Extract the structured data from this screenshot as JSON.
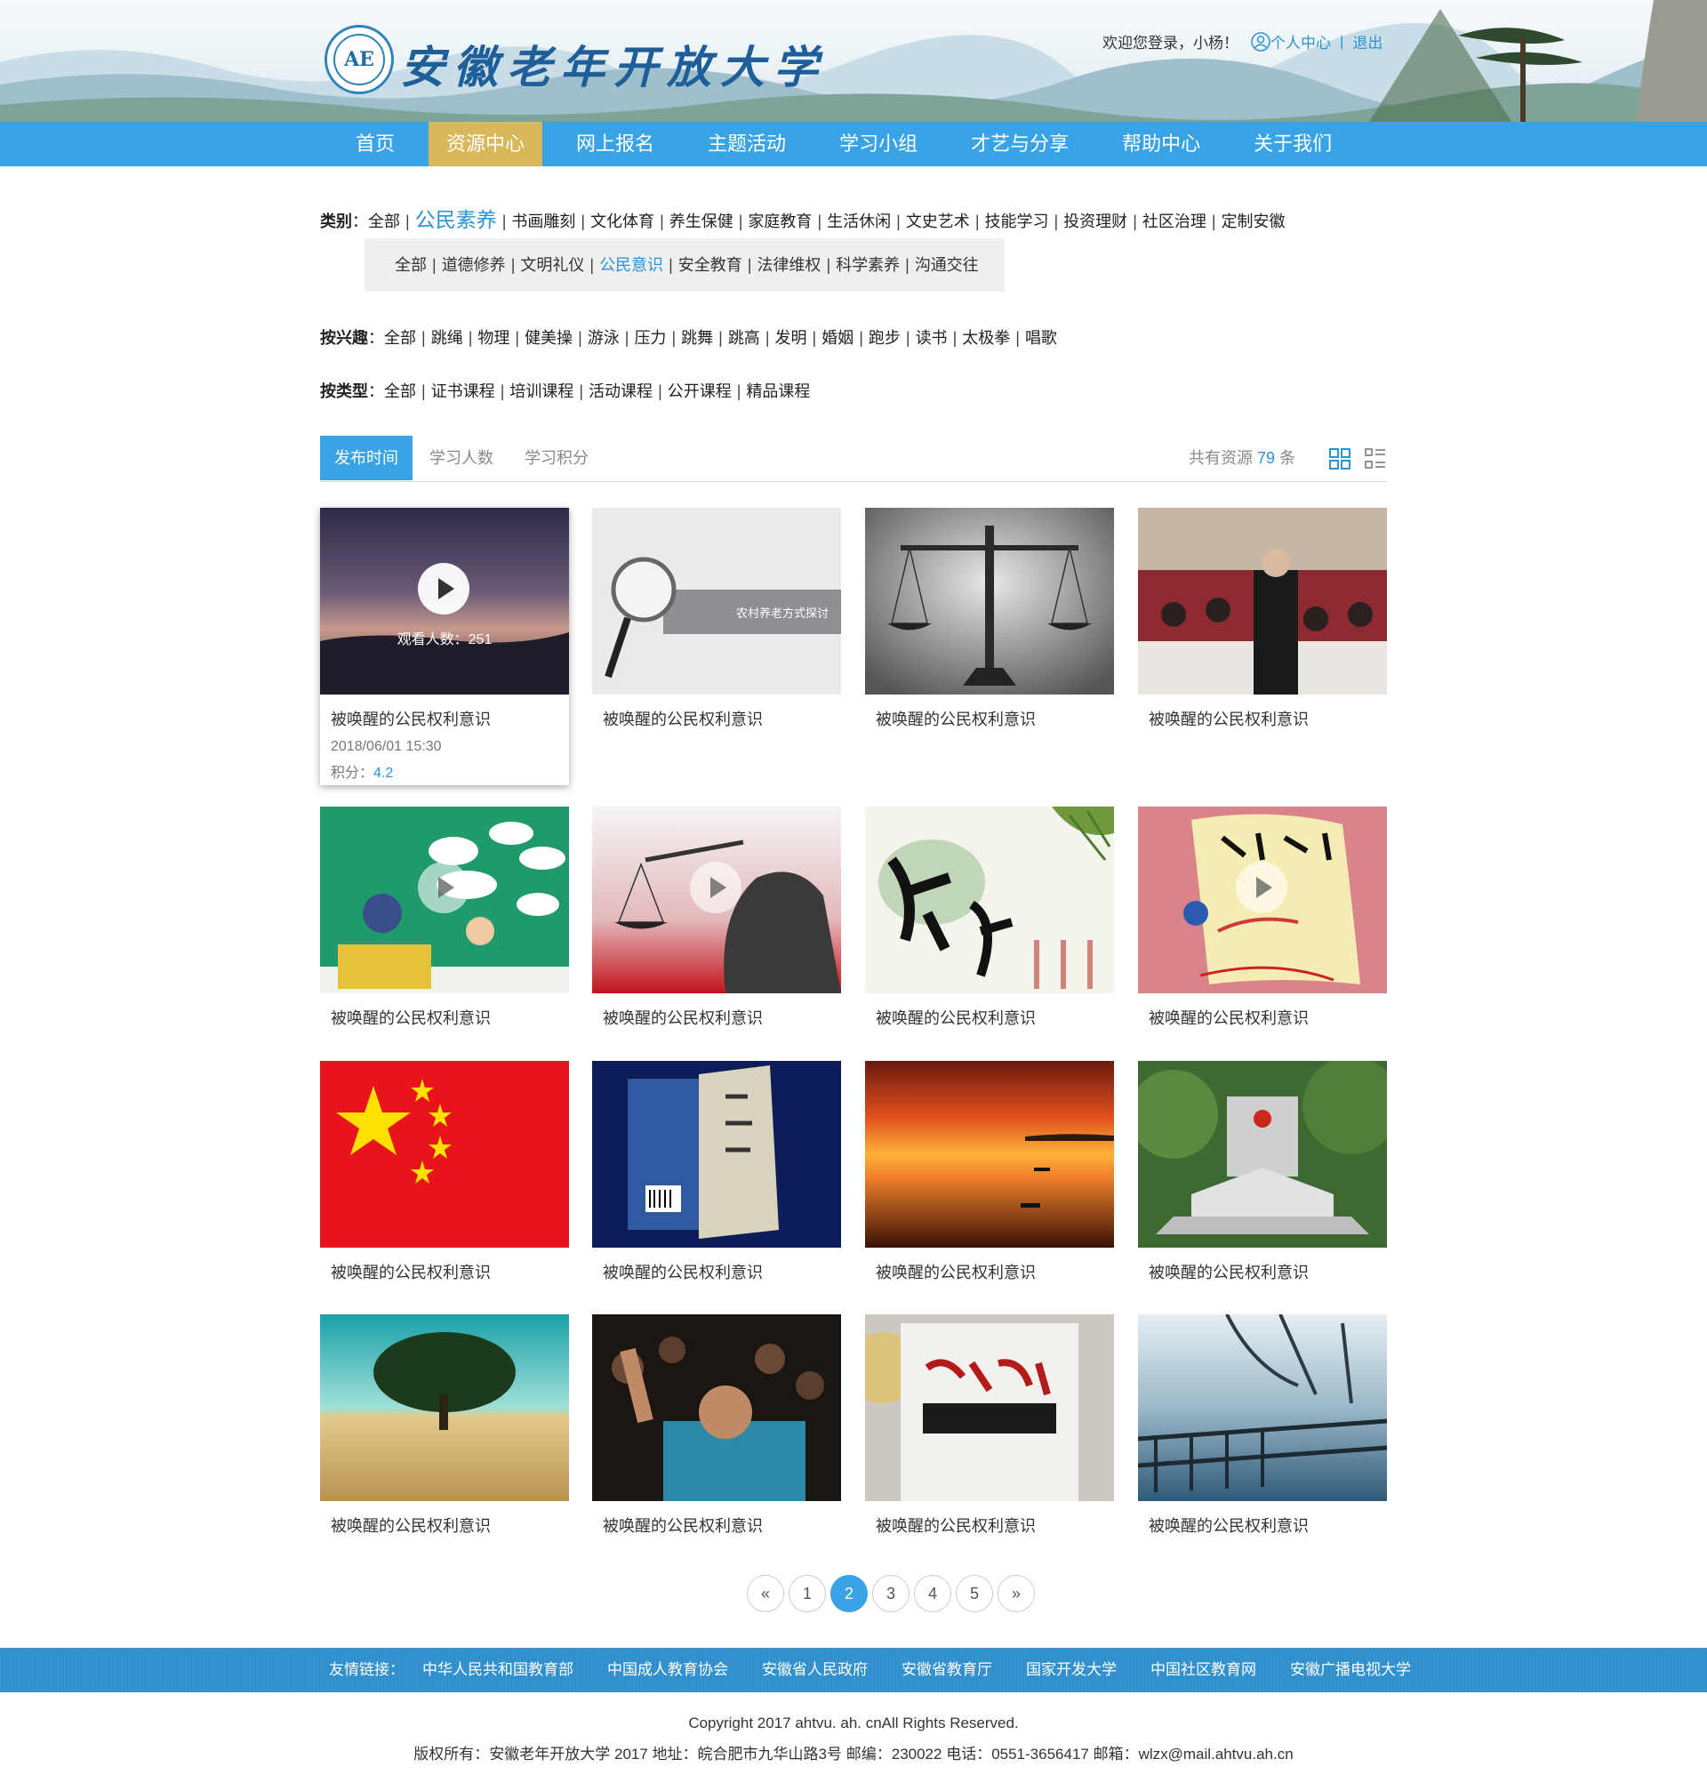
{
  "header": {
    "site_title": "安徽老年开放大学",
    "logo_glyph": "AE",
    "welcome": "欢迎您登录，小杨！",
    "user_center": "个人中心",
    "separator": "|",
    "logout": "退出"
  },
  "nav": {
    "items": [
      "首页",
      "资源中心",
      "网上报名",
      "主题活动",
      "学习小组",
      "才艺与分享",
      "帮助中心",
      "关于我们"
    ],
    "active": "资源中心"
  },
  "filters": {
    "category_label": "类别",
    "category_options": [
      "全部",
      "公民素养",
      "书画雕刻",
      "文化体育",
      "养生保健",
      "家庭教育",
      "生活休闲",
      "文史艺术",
      "技能学习",
      "投资理财",
      "社区治理",
      "定制安徽"
    ],
    "category_selected": "公民素养",
    "sub_options": [
      "全部",
      "道德修养",
      "文明礼仪",
      "公民意识",
      "安全教育",
      "法律维权",
      "科学素养",
      "沟通交往"
    ],
    "sub_selected": "公民意识",
    "interest_label": "按兴趣",
    "interest_options": [
      "全部",
      "跳绳",
      "物理",
      "健美操",
      "游泳",
      "压力",
      "跳舞",
      "跳高",
      "发明",
      "婚姻",
      "跑步",
      "读书",
      "太极拳",
      "唱歌"
    ],
    "type_label": "按类型",
    "type_options": [
      "全部",
      "证书课程",
      "培训课程",
      "活动课程",
      "公开课程",
      "精品课程"
    ]
  },
  "sort": {
    "tabs": [
      "发布时间",
      "学习人数",
      "学习积分"
    ],
    "active": "发布时间",
    "count_prefix": "共有资源",
    "count": "79",
    "count_suffix": "条"
  },
  "cards": [
    {
      "title": "被唤醒的公民权利意识",
      "views_label": "观看人数：251",
      "date": "2018/06/01 15:30",
      "score_label": "积分：",
      "score": "4.2",
      "image": "purple-sunset-lake"
    },
    {
      "title": "被唤醒的公民权利意识",
      "image": "magnifier-banner",
      "banner_text": "农村养老方式探讨"
    },
    {
      "title": "被唤醒的公民权利意识",
      "image": "justice-scale"
    },
    {
      "title": "被唤醒的公民权利意识",
      "image": "classroom"
    },
    {
      "title": "被唤醒的公民权利意识",
      "image": "cartoon-household-registration"
    },
    {
      "title": "被唤醒的公民权利意识",
      "image": "lady-justice-statue"
    },
    {
      "title": "被唤醒的公民权利意识",
      "image": "calligraphy-rights"
    },
    {
      "title": "被唤醒的公民权利意识",
      "image": "citizen-awareness-scroll"
    },
    {
      "title": "被唤醒的公民权利意识",
      "image": "china-flag"
    },
    {
      "title": "被唤醒的公民权利意识",
      "image": "book-cover"
    },
    {
      "title": "被唤醒的公民权利意识",
      "image": "sunset-boat"
    },
    {
      "title": "被唤醒的公民权利意识",
      "image": "constitution-monument"
    },
    {
      "title": "被唤醒的公民权利意识",
      "image": "lone-tree"
    },
    {
      "title": "被唤醒的公民权利意识",
      "image": "crowd-protest"
    },
    {
      "title": "被唤醒的公民权利意识",
      "image": "citizen-rights-handbook"
    },
    {
      "title": "被唤醒的公民权利意识",
      "image": "misty-bridge"
    }
  ],
  "pagination": {
    "prev": "«",
    "pages": [
      "1",
      "2",
      "3",
      "4",
      "5"
    ],
    "current": "2",
    "next": "»"
  },
  "footer": {
    "links_label": "友情链接：",
    "links": [
      "中华人民共和国教育部",
      "中国成人教育协会",
      "安徽省人民政府",
      "安徽省教育厅",
      "国家开发大学",
      "中国社区教育网",
      "安徽广播电视大学"
    ],
    "copyright": "Copyright 2017 ahtvu. ah. cnAll Rights Reserved.",
    "address": "版权所有：安徽老年开放大学 2017 地址：皖合肥市九华山路3号 邮编：230022 电话：0551-3656417 邮箱：wlzx@mail.ahtvu.ah.cn"
  },
  "colors": {
    "accent_blue": "#39a3e6",
    "nav_active_gold": "#d8b85a",
    "link_blue": "#2a93d6",
    "footer_blue": "#2e8fcd"
  }
}
